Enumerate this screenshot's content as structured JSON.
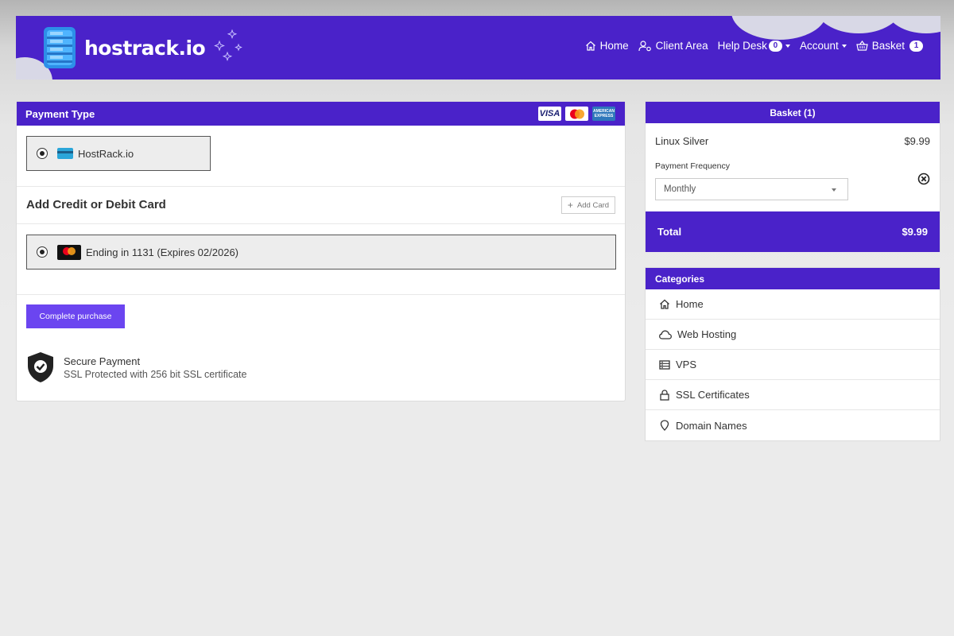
{
  "brand": {
    "name": "hostrack.io"
  },
  "nav": {
    "home": "Home",
    "client_area": "Client Area",
    "help_desk": "Help Desk",
    "help_desk_count": "0",
    "account": "Account",
    "basket": "Basket",
    "basket_count": "1"
  },
  "payment": {
    "header": "Payment Type",
    "card_logos": [
      "VISA",
      "Mastercard",
      "American Express"
    ],
    "method_label": "HostRack.io",
    "add_card_title": "Add Credit or Debit Card",
    "add_card_button": "Add Card",
    "saved_card_label": "Ending in 1131 (Expires 02/2026)",
    "complete_button": "Complete purchase",
    "secure_title": "Secure Payment",
    "secure_subtitle": "SSL Protected with 256 bit SSL certificate"
  },
  "basket": {
    "header": "Basket (1)",
    "item_name": "Linux Silver",
    "item_price": "$9.99",
    "frequency_label": "Payment Frequency",
    "frequency_value": "Monthly",
    "total_label": "Total",
    "total_value": "$9.99"
  },
  "categories": {
    "header": "Categories",
    "items": [
      {
        "label": "Home",
        "icon": "home-icon"
      },
      {
        "label": "Web Hosting",
        "icon": "cloud-icon"
      },
      {
        "label": "VPS",
        "icon": "server-icon"
      },
      {
        "label": "SSL Certificates",
        "icon": "lock-icon"
      },
      {
        "label": "Domain Names",
        "icon": "map-pin-icon"
      }
    ]
  },
  "colors": {
    "brand_purple": "#4a22c9",
    "button_purple": "#6b45f0"
  }
}
